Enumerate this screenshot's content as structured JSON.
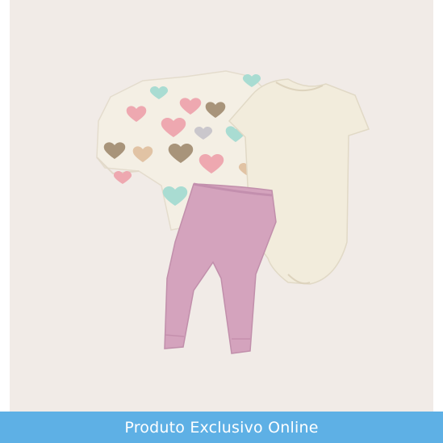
{
  "product_image": {
    "alt": "",
    "items": [
      "hearts-sweatshirt",
      "cream-bodysuit",
      "pink-leggings"
    ],
    "colors": {
      "background": "#f1ebe7",
      "sweatshirt": "#f4efe4",
      "bodysuit": "#f2ecdc",
      "leggings": "#d4a3bd",
      "heart_pink": "#eea8b0",
      "heart_mint": "#a9dcd2",
      "heart_brown": "#a8947a",
      "heart_tan": "#e1c3a4",
      "heart_grey": "#cac7cc"
    }
  },
  "banner": {
    "text": "Produto Exclusivo Online",
    "background": "#5eb0e5",
    "text_color": "#ffffff"
  }
}
